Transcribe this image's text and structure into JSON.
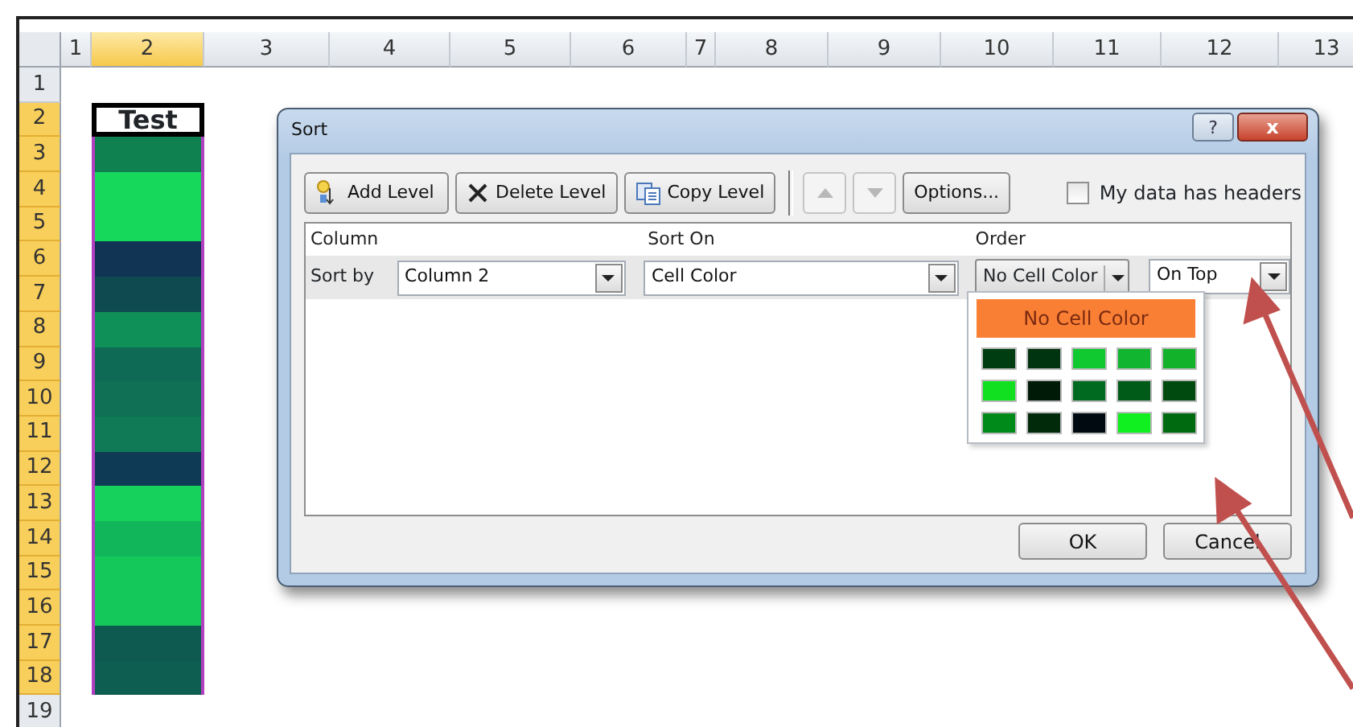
{
  "sheet": {
    "columns": [
      {
        "label": "1",
        "selected": false
      },
      {
        "label": "2",
        "selected": true
      },
      {
        "label": "3",
        "selected": false
      },
      {
        "label": "4",
        "selected": false
      },
      {
        "label": "5",
        "selected": false
      },
      {
        "label": "6",
        "selected": false
      },
      {
        "label": "7",
        "selected": false
      },
      {
        "label": "8",
        "selected": false
      },
      {
        "label": "9",
        "selected": false
      },
      {
        "label": "10",
        "selected": false
      },
      {
        "label": "11",
        "selected": false
      },
      {
        "label": "12",
        "selected": false
      },
      {
        "label": "13",
        "selected": false
      }
    ],
    "rows": [
      {
        "label": "1",
        "selected": false
      },
      {
        "label": "2",
        "selected": true
      },
      {
        "label": "3",
        "selected": true
      },
      {
        "label": "4",
        "selected": true
      },
      {
        "label": "5",
        "selected": true
      },
      {
        "label": "6",
        "selected": true
      },
      {
        "label": "7",
        "selected": true
      },
      {
        "label": "8",
        "selected": true
      },
      {
        "label": "9",
        "selected": true
      },
      {
        "label": "10",
        "selected": true
      },
      {
        "label": "11",
        "selected": true
      },
      {
        "label": "12",
        "selected": true
      },
      {
        "label": "13",
        "selected": true
      },
      {
        "label": "14",
        "selected": true
      },
      {
        "label": "15",
        "selected": true
      },
      {
        "label": "16",
        "selected": true
      },
      {
        "label": "17",
        "selected": true
      },
      {
        "label": "18",
        "selected": true
      },
      {
        "label": "19",
        "selected": false
      }
    ],
    "header_cell": "Test",
    "fill_cells": [
      {
        "color": "#0f8050"
      },
      {
        "color": "#16d95c"
      },
      {
        "color": "#16d95c"
      },
      {
        "color": "#113354"
      },
      {
        "color": "#0f4a50"
      },
      {
        "color": "#0f9058"
      },
      {
        "color": "#0f6a55"
      },
      {
        "color": "#0f7055"
      },
      {
        "color": "#0f7a55"
      },
      {
        "color": "#0f3a55"
      },
      {
        "color": "#16d25c"
      },
      {
        "color": "#12b65a"
      },
      {
        "color": "#14c85a"
      },
      {
        "color": "#14c85a"
      },
      {
        "color": "#0f5a50"
      },
      {
        "color": "#0f5e52"
      }
    ]
  },
  "dialog": {
    "title": "Sort",
    "help": "?",
    "close": "x",
    "toolbar": [
      {
        "kind": "add",
        "label": "Add Level",
        "disabled": false
      },
      {
        "kind": "delete",
        "label": "Delete Level",
        "disabled": false
      },
      {
        "kind": "copy",
        "label": "Copy Level",
        "disabled": false
      },
      {
        "kind": "up",
        "disabled": true
      },
      {
        "kind": "down",
        "disabled": true
      },
      {
        "kind": "text",
        "label": "Options...",
        "disabled": false
      }
    ],
    "headers_checkbox": {
      "label": "My data has headers",
      "checked": false
    },
    "columns": [
      "Column",
      "Sort On",
      "Order"
    ],
    "level": {
      "label": "Sort by",
      "column": "Column 2",
      "sort_on": "Cell Color",
      "order_color": "No Cell Color",
      "order_position": "On Top"
    },
    "color_menu": {
      "items": [
        {
          "label": "No Cell Color",
          "selected": true
        }
      ],
      "swatches": [
        {
          "color": "#003d10"
        },
        {
          "color": "#00330f"
        },
        {
          "color": "#10c830"
        },
        {
          "color": "#12b530"
        },
        {
          "color": "#12b32a"
        },
        {
          "color": "#10e020"
        },
        {
          "color": "#001a08"
        },
        {
          "color": "#006a20"
        },
        {
          "color": "#005a18"
        },
        {
          "color": "#004a10"
        },
        {
          "color": "#008a1a"
        },
        {
          "color": "#002a0a"
        },
        {
          "color": "#000a10"
        },
        {
          "color": "#10f020"
        },
        {
          "color": "#006a10"
        }
      ]
    },
    "buttons": [
      "OK",
      "Cancel"
    ]
  }
}
